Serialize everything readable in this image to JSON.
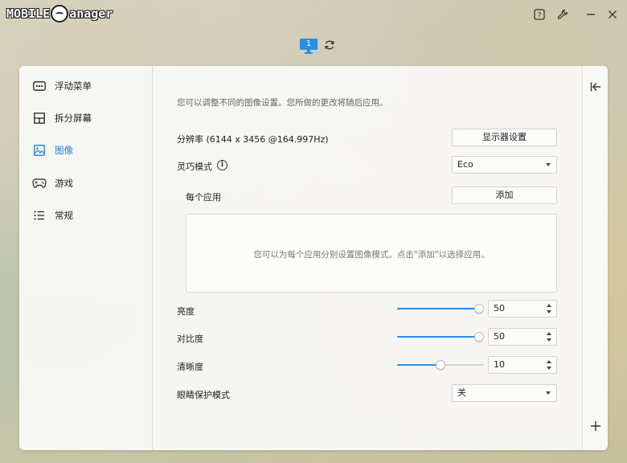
{
  "app": {
    "logo_left": "MOBILE",
    "logo_right": "anager"
  },
  "window": {
    "help_icon": "help-icon",
    "settings_icon": "wrench-icon",
    "minimize_icon": "minimize-icon",
    "close_icon": "close-icon"
  },
  "monitor_tab": {
    "number": "1"
  },
  "sidebar": {
    "items": [
      {
        "label": "浮动菜单",
        "icon": "floating-menu-icon",
        "active": false
      },
      {
        "label": "拆分屏幕",
        "icon": "split-screen-icon",
        "active": false
      },
      {
        "label": "图像",
        "icon": "image-icon",
        "active": true
      },
      {
        "label": "游戏",
        "icon": "gamepad-icon",
        "active": false
      },
      {
        "label": "常规",
        "icon": "list-icon",
        "active": false
      }
    ]
  },
  "content": {
    "hint": "您可以调整不同的图像设置。您所做的更改将随后应用。",
    "resolution_label": "分辨率 (6144 x 3456 @164.997Hz)",
    "display_settings_button": "显示器设置",
    "smart_mode_label": "灵巧模式",
    "smart_mode_value": "Eco",
    "per_app_label": "每个应用",
    "add_button": "添加",
    "per_app_empty": "您可以为每个应用分别设置图像模式。点击\"添加\"以选择应用。",
    "brightness_label": "亮度",
    "brightness_value": "50",
    "contrast_label": "对比度",
    "contrast_value": "50",
    "sharpness_label": "清晰度",
    "sharpness_value": "10",
    "eye_care_label": "眼睛保护模式",
    "eye_care_value": "关"
  },
  "sliders": {
    "brightness": {
      "value": 50,
      "max": 50
    },
    "contrast": {
      "value": 50,
      "max": 50
    },
    "sharpness": {
      "value": 10,
      "max": 20
    }
  },
  "colors": {
    "accent": "#2b8de4"
  }
}
